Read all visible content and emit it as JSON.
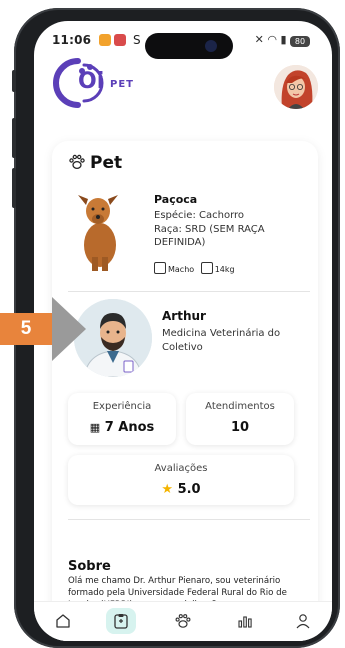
{
  "status_bar": {
    "time": "11:06",
    "s_label": "S",
    "dot": "•",
    "battery": "80"
  },
  "header": {
    "brand_oi": "Oi",
    "brand_pet": "PET"
  },
  "section": {
    "title": "Pet"
  },
  "pet": {
    "name": "Paçoca",
    "species": "Espécie: Cachorro",
    "breed": "Raça: SRD (SEM RAÇA DEFINIDA)",
    "sex": "Macho",
    "weight": "14kg"
  },
  "vet": {
    "name": "Arthur",
    "role": "Medicina Veterinária do Coletivo"
  },
  "stats": {
    "experience_label": "Experiência",
    "experience_value": "7 Anos",
    "appointments_label": "Atendimentos",
    "appointments_value": "10",
    "rating_label": "Avaliações",
    "rating_value": "5.0"
  },
  "about": {
    "title": "Sobre",
    "text": "Olá me chamo Dr. Arthur Pienaro, sou veterinário formado pela Universidade Federal Rural do Rio de Janeiro (UFRRJ), com especializações nas"
  },
  "annotation": {
    "badge": "5"
  },
  "nav": {
    "items": [
      "home-icon",
      "clipboard-icon",
      "paw-icon",
      "chart-icon",
      "user-icon"
    ]
  },
  "colors": {
    "brand": "#5b3fb8",
    "accent": "#2db8a5",
    "badge": "#e8843c",
    "star": "#f4b400"
  }
}
